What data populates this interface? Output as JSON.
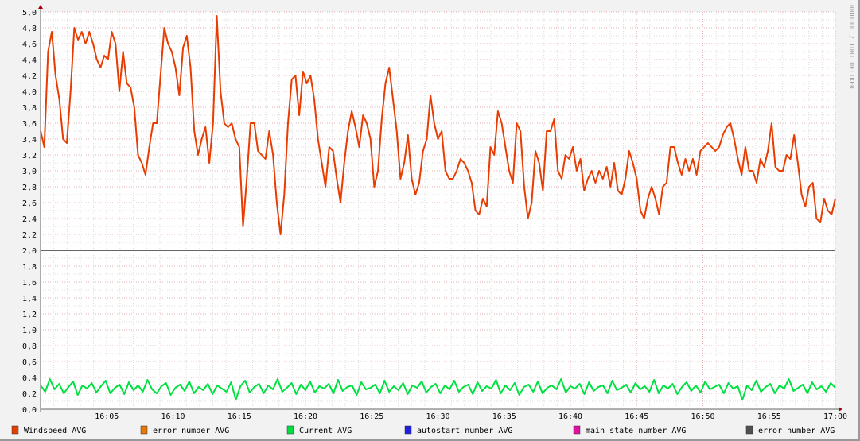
{
  "chart_data": {
    "type": "line",
    "title": "",
    "xlabel": "",
    "ylabel": "",
    "x_range": [
      "16:00",
      "17:00"
    ],
    "ylim": [
      0,
      5.0
    ],
    "grid": true,
    "y_ticks": [
      "0,0",
      "0,2",
      "0,4",
      "0,6",
      "0,8",
      "1,0",
      "1,2",
      "1,4",
      "1,6",
      "1,8",
      "2,0",
      "2,2",
      "2,4",
      "2,6",
      "2,8",
      "3,0",
      "3,2",
      "3,4",
      "3,6",
      "3,8",
      "4,0",
      "4,2",
      "4,4",
      "4,6",
      "4,8",
      "5,0"
    ],
    "x_ticks": [
      "16:05",
      "16:10",
      "16:15",
      "16:20",
      "16:25",
      "16:30",
      "16:35",
      "16:40",
      "16:45",
      "16:50",
      "16:55",
      "17:00"
    ],
    "hrule": {
      "value": 2.0,
      "color": "#333333"
    },
    "watermark": "RRDTOOL / TOBI OETIKER",
    "legend_placement": "bottom",
    "legend": [
      {
        "name": "Windspeed AVG",
        "color": "#e83c00"
      },
      {
        "name": "error_number AVG",
        "color": "#e87800"
      },
      {
        "name": "Current AVG",
        "color": "#00e040"
      },
      {
        "name": "autostart_number AVG",
        "color": "#2020e0"
      },
      {
        "name": "main_state_number AVG",
        "color": "#e010a0"
      },
      {
        "name": "error_number AVG",
        "color": "#505050"
      }
    ],
    "series": [
      {
        "name": "Windspeed AVG",
        "color": "#e83c00",
        "values": [
          3.5,
          3.3,
          4.5,
          4.75,
          4.2,
          3.9,
          3.4,
          3.35,
          4.0,
          4.8,
          4.65,
          4.75,
          4.6,
          4.75,
          4.6,
          4.4,
          4.3,
          4.45,
          4.4,
          4.75,
          4.6,
          4.0,
          4.5,
          4.1,
          4.05,
          3.8,
          3.2,
          3.1,
          2.95,
          3.3,
          3.6,
          3.6,
          4.2,
          4.8,
          4.6,
          4.5,
          4.3,
          3.95,
          4.55,
          4.7,
          4.3,
          3.5,
          3.2,
          3.4,
          3.55,
          3.1,
          3.6,
          4.95,
          4.0,
          3.6,
          3.55,
          3.6,
          3.4,
          3.3,
          2.3,
          2.9,
          3.6,
          3.6,
          3.25,
          3.2,
          3.15,
          3.5,
          3.2,
          2.6,
          2.2,
          2.7,
          3.6,
          4.15,
          4.2,
          3.7,
          4.25,
          4.1,
          4.2,
          3.9,
          3.4,
          3.1,
          2.8,
          3.3,
          3.25,
          2.9,
          2.6,
          3.1,
          3.5,
          3.75,
          3.55,
          3.3,
          3.7,
          3.6,
          3.4,
          2.8,
          3.0,
          3.65,
          4.1,
          4.3,
          3.9,
          3.5,
          2.9,
          3.1,
          3.45,
          2.9,
          2.7,
          2.85,
          3.25,
          3.4,
          3.95,
          3.6,
          3.4,
          3.5,
          3.0,
          2.9,
          2.9,
          3.0,
          3.15,
          3.1,
          3.0,
          2.85,
          2.5,
          2.45,
          2.65,
          2.55,
          3.3,
          3.2,
          3.75,
          3.6,
          3.3,
          3.0,
          2.85,
          3.6,
          3.5,
          2.8,
          2.4,
          2.6,
          3.25,
          3.1,
          2.75,
          3.5,
          3.5,
          3.65,
          3.0,
          2.9,
          3.2,
          3.15,
          3.3,
          3.0,
          3.15,
          2.75,
          2.9,
          3.0,
          2.85,
          3.0,
          2.9,
          3.05,
          2.8,
          3.1,
          2.75,
          2.7,
          2.9,
          3.25,
          3.1,
          2.9,
          2.5,
          2.4,
          2.65,
          2.8,
          2.65,
          2.45,
          2.8,
          2.85,
          3.3,
          3.3,
          3.1,
          2.95,
          3.15,
          3.0,
          3.15,
          2.95,
          3.25,
          3.3,
          3.35,
          3.3,
          3.25,
          3.3,
          3.45,
          3.55,
          3.6,
          3.4,
          3.15,
          2.95,
          3.3,
          3.0,
          3.0,
          2.85,
          3.15,
          3.05,
          3.25,
          3.6,
          3.05,
          3.0,
          3.0,
          3.2,
          3.15,
          3.45,
          3.1,
          2.7,
          2.55,
          2.8,
          2.85,
          2.4,
          2.35,
          2.65,
          2.5,
          2.45,
          2.65
        ]
      },
      {
        "name": "Current AVG",
        "color": "#00e040",
        "values": [
          0.3,
          0.22,
          0.38,
          0.25,
          0.32,
          0.2,
          0.28,
          0.35,
          0.18,
          0.3,
          0.26,
          0.33,
          0.21,
          0.29,
          0.36,
          0.2,
          0.27,
          0.31,
          0.19,
          0.34,
          0.24,
          0.3,
          0.22,
          0.37,
          0.25,
          0.2,
          0.29,
          0.33,
          0.18,
          0.27,
          0.31,
          0.23,
          0.35,
          0.2,
          0.28,
          0.24,
          0.32,
          0.19,
          0.3,
          0.26,
          0.22,
          0.34,
          0.12,
          0.29,
          0.36,
          0.21,
          0.28,
          0.32,
          0.2,
          0.3,
          0.25,
          0.38,
          0.22,
          0.27,
          0.33,
          0.19,
          0.31,
          0.24,
          0.35,
          0.21,
          0.29,
          0.26,
          0.32,
          0.2,
          0.37,
          0.23,
          0.28,
          0.3,
          0.18,
          0.34,
          0.25,
          0.27,
          0.31,
          0.2,
          0.36,
          0.22,
          0.29,
          0.24,
          0.33,
          0.19,
          0.3,
          0.27,
          0.35,
          0.21,
          0.28,
          0.32,
          0.2,
          0.3,
          0.25,
          0.36,
          0.22,
          0.28,
          0.31,
          0.19,
          0.34,
          0.23,
          0.29,
          0.26,
          0.37,
          0.2,
          0.3,
          0.24,
          0.33,
          0.18,
          0.28,
          0.31,
          0.22,
          0.35,
          0.2,
          0.27,
          0.3,
          0.25,
          0.38,
          0.21,
          0.29,
          0.26,
          0.32,
          0.19,
          0.34,
          0.23,
          0.28,
          0.3,
          0.2,
          0.36,
          0.24,
          0.27,
          0.31,
          0.21,
          0.33,
          0.25,
          0.29,
          0.22,
          0.37,
          0.2,
          0.3,
          0.26,
          0.32,
          0.19,
          0.28,
          0.34,
          0.23,
          0.3,
          0.21,
          0.35,
          0.25,
          0.28,
          0.31,
          0.2,
          0.33,
          0.26,
          0.29,
          0.12,
          0.3,
          0.24,
          0.36,
          0.22,
          0.28,
          0.32,
          0.2,
          0.3,
          0.26,
          0.38,
          0.23,
          0.27,
          0.31,
          0.2,
          0.34,
          0.25,
          0.29,
          0.22,
          0.33,
          0.27
        ]
      }
    ]
  }
}
